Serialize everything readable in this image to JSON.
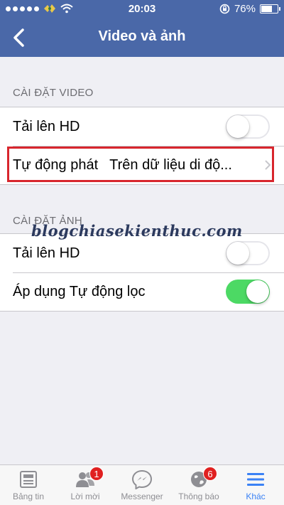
{
  "status_bar": {
    "time": "20:03",
    "battery_text": "76%",
    "battery_level": 0.76,
    "signal_dots_filled": 5,
    "icons": [
      "carrier-logo-icon",
      "wifi-icon",
      "rotation-lock-icon",
      "battery-icon"
    ]
  },
  "nav": {
    "title": "Video và ảnh",
    "back_icon": "chevron-left-icon"
  },
  "video_section": {
    "header": "CÀI ĐẶT VIDEO",
    "upload_hd_label": "Tải lên HD",
    "upload_hd_on": false,
    "autoplay_label": "Tự động phát",
    "autoplay_value": "Trên dữ liệu di độ..."
  },
  "photo_section": {
    "header": "CÀI ĐẶT ẢNH",
    "upload_hd_label": "Tải lên HD",
    "upload_hd_on": false,
    "auto_filter_label": "Áp dụng Tự động lọc",
    "auto_filter_on": true
  },
  "watermark": "blogchiasekienthuc.com",
  "tabbar": {
    "tabs": [
      {
        "label": "Bảng tin",
        "icon": "news-feed-icon",
        "badge": ""
      },
      {
        "label": "Lời mời",
        "icon": "friend-requests-icon",
        "badge": "1"
      },
      {
        "label": "Messenger",
        "icon": "messenger-icon",
        "badge": ""
      },
      {
        "label": "Thông báo",
        "icon": "globe-icon",
        "badge": "6"
      },
      {
        "label": "Khác",
        "icon": "menu-icon",
        "badge": ""
      }
    ],
    "active_index": 4
  },
  "colors": {
    "nav_bar": "#4a68a8",
    "toggle_on": "#4cd964",
    "highlight_box": "#d8262d",
    "active_tab": "#3b82f5",
    "badge": "#e02020"
  }
}
